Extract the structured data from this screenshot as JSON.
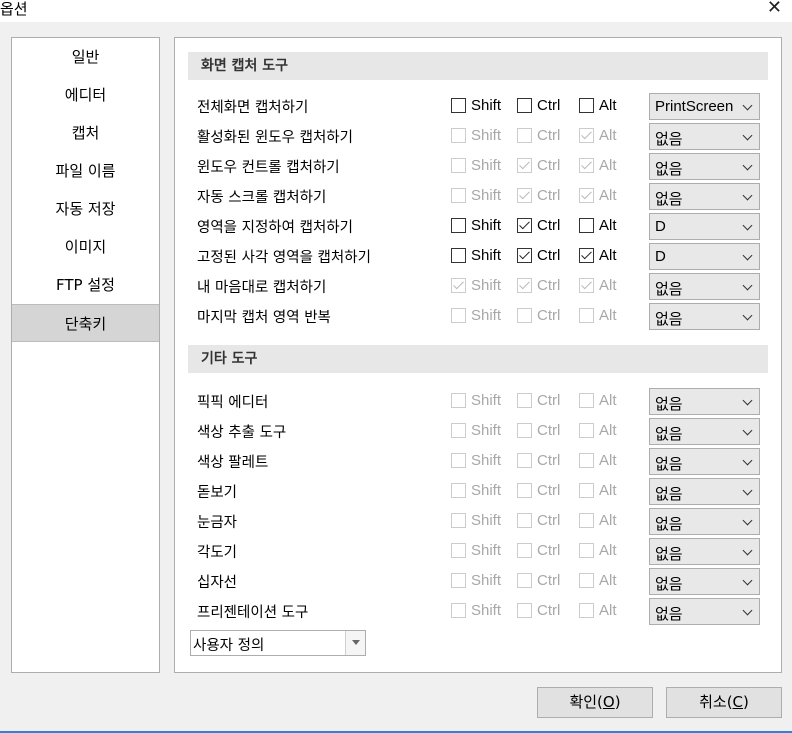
{
  "window": {
    "title": "옵션",
    "close_icon": "close-icon"
  },
  "sidebar": {
    "items": [
      {
        "label": "일반"
      },
      {
        "label": "에디터"
      },
      {
        "label": "캡처"
      },
      {
        "label": "파일 이름"
      },
      {
        "label": "자동 저장"
      },
      {
        "label": "이미지"
      },
      {
        "label": "FTP 설정"
      },
      {
        "label": "단축키",
        "active": true
      }
    ]
  },
  "sections": [
    {
      "title": "화면 캡처 도구",
      "rows": [
        {
          "label": "전체화면 캡처하기",
          "shift": {
            "label": "Shift",
            "checked": false,
            "enabled": true
          },
          "ctrl": {
            "label": "Ctrl",
            "checked": false,
            "enabled": true
          },
          "alt": {
            "label": "Alt",
            "checked": false,
            "enabled": true
          },
          "key": "PrintScreen"
        },
        {
          "label": "활성화된 윈도우 캡처하기",
          "shift": {
            "label": "Shift",
            "checked": false,
            "enabled": false
          },
          "ctrl": {
            "label": "Ctrl",
            "checked": false,
            "enabled": false
          },
          "alt": {
            "label": "Alt",
            "checked": true,
            "enabled": false
          },
          "key": "없음"
        },
        {
          "label": "윈도우 컨트롤 캡처하기",
          "shift": {
            "label": "Shift",
            "checked": false,
            "enabled": false
          },
          "ctrl": {
            "label": "Ctrl",
            "checked": true,
            "enabled": false
          },
          "alt": {
            "label": "Alt",
            "checked": true,
            "enabled": false
          },
          "key": "없음"
        },
        {
          "label": "자동 스크롤 캡처하기",
          "shift": {
            "label": "Shift",
            "checked": false,
            "enabled": false
          },
          "ctrl": {
            "label": "Ctrl",
            "checked": true,
            "enabled": false
          },
          "alt": {
            "label": "Alt",
            "checked": true,
            "enabled": false
          },
          "key": "없음"
        },
        {
          "label": "영역을 지정하여 캡처하기",
          "shift": {
            "label": "Shift",
            "checked": false,
            "enabled": true
          },
          "ctrl": {
            "label": "Ctrl",
            "checked": true,
            "enabled": true
          },
          "alt": {
            "label": "Alt",
            "checked": false,
            "enabled": true
          },
          "key": "D"
        },
        {
          "label": "고정된 사각 영역을 캡처하기",
          "shift": {
            "label": "Shift",
            "checked": false,
            "enabled": true
          },
          "ctrl": {
            "label": "Ctrl",
            "checked": true,
            "enabled": true
          },
          "alt": {
            "label": "Alt",
            "checked": true,
            "enabled": true
          },
          "key": "D"
        },
        {
          "label": "내 마음대로 캡처하기",
          "shift": {
            "label": "Shift",
            "checked": true,
            "enabled": false
          },
          "ctrl": {
            "label": "Ctrl",
            "checked": true,
            "enabled": false
          },
          "alt": {
            "label": "Alt",
            "checked": true,
            "enabled": false
          },
          "key": "없음"
        },
        {
          "label": "마지막 캡처 영역 반복",
          "shift": {
            "label": "Shift",
            "checked": false,
            "enabled": false
          },
          "ctrl": {
            "label": "Ctrl",
            "checked": false,
            "enabled": false
          },
          "alt": {
            "label": "Alt",
            "checked": false,
            "enabled": false
          },
          "key": "없음"
        }
      ]
    },
    {
      "title": "기타 도구",
      "rows": [
        {
          "label": "픽픽 에디터",
          "shift": {
            "label": "Shift",
            "checked": false,
            "enabled": false
          },
          "ctrl": {
            "label": "Ctrl",
            "checked": false,
            "enabled": false
          },
          "alt": {
            "label": "Alt",
            "checked": false,
            "enabled": false
          },
          "key": "없음"
        },
        {
          "label": "색상 추출 도구",
          "shift": {
            "label": "Shift",
            "checked": false,
            "enabled": false
          },
          "ctrl": {
            "label": "Ctrl",
            "checked": false,
            "enabled": false
          },
          "alt": {
            "label": "Alt",
            "checked": false,
            "enabled": false
          },
          "key": "없음"
        },
        {
          "label": "색상 팔레트",
          "shift": {
            "label": "Shift",
            "checked": false,
            "enabled": false
          },
          "ctrl": {
            "label": "Ctrl",
            "checked": false,
            "enabled": false
          },
          "alt": {
            "label": "Alt",
            "checked": false,
            "enabled": false
          },
          "key": "없음"
        },
        {
          "label": "돋보기",
          "shift": {
            "label": "Shift",
            "checked": false,
            "enabled": false
          },
          "ctrl": {
            "label": "Ctrl",
            "checked": false,
            "enabled": false
          },
          "alt": {
            "label": "Alt",
            "checked": false,
            "enabled": false
          },
          "key": "없음"
        },
        {
          "label": "눈금자",
          "shift": {
            "label": "Shift",
            "checked": false,
            "enabled": false
          },
          "ctrl": {
            "label": "Ctrl",
            "checked": false,
            "enabled": false
          },
          "alt": {
            "label": "Alt",
            "checked": false,
            "enabled": false
          },
          "key": "없음"
        },
        {
          "label": "각도기",
          "shift": {
            "label": "Shift",
            "checked": false,
            "enabled": false
          },
          "ctrl": {
            "label": "Ctrl",
            "checked": false,
            "enabled": false
          },
          "alt": {
            "label": "Alt",
            "checked": false,
            "enabled": false
          },
          "key": "없음"
        },
        {
          "label": "십자선",
          "shift": {
            "label": "Shift",
            "checked": false,
            "enabled": false
          },
          "ctrl": {
            "label": "Ctrl",
            "checked": false,
            "enabled": false
          },
          "alt": {
            "label": "Alt",
            "checked": false,
            "enabled": false
          },
          "key": "없음"
        },
        {
          "label": "프리젠테이션 도구",
          "shift": {
            "label": "Shift",
            "checked": false,
            "enabled": false
          },
          "ctrl": {
            "label": "Ctrl",
            "checked": false,
            "enabled": false
          },
          "alt": {
            "label": "Alt",
            "checked": false,
            "enabled": false
          },
          "key": "없음"
        }
      ]
    }
  ],
  "profile_select": {
    "value": "사용자 정의"
  },
  "buttons": {
    "ok": {
      "label": "확인(",
      "mnemonic": "O",
      "suffix": ")"
    },
    "cancel": {
      "label": "취소(",
      "mnemonic": "C",
      "suffix": ")"
    }
  }
}
